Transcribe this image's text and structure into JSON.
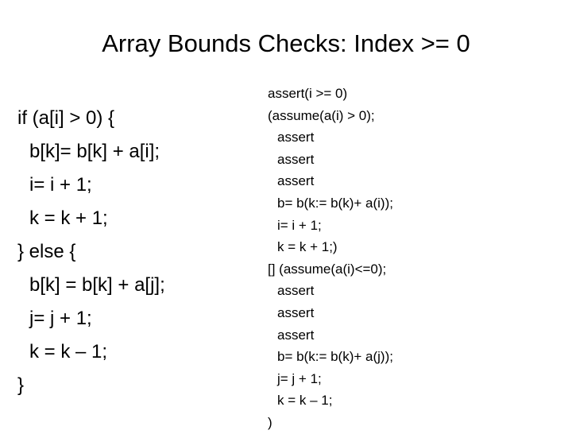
{
  "slide": {
    "title": "Array Bounds Checks: Index >= 0",
    "background_color": "#ffffff",
    "text_color": "#000000"
  },
  "left_code": {
    "name": "source-program",
    "lines": [
      {
        "text": "if (a[i] > 0) {",
        "indent": 0
      },
      {
        "text": "b[k]= b[k] + a[i];",
        "indent": 1
      },
      {
        "text": "i= i + 1;",
        "indent": 1
      },
      {
        "text": "k = k + 1;",
        "indent": 1
      },
      {
        "text": "} else {",
        "indent": 0
      },
      {
        "text": "b[k] = b[k] + a[j];",
        "indent": 1
      },
      {
        "text": "j= j + 1;",
        "indent": 1
      },
      {
        "text": "k = k – 1;",
        "indent": 1
      },
      {
        "text": "}",
        "indent": 0
      }
    ]
  },
  "right_code": {
    "name": "guarded-command-translation",
    "lines": [
      {
        "text": "assert(i >= 0)",
        "indent": 0
      },
      {
        "text": "(assume(a(i) > 0);",
        "indent": 0
      },
      {
        "text": "assert",
        "indent": 1
      },
      {
        "text": "assert",
        "indent": 1
      },
      {
        "text": "assert",
        "indent": 1
      },
      {
        "text": "b= b(k:= b(k)+ a(i));",
        "indent": 1
      },
      {
        "text": "i= i + 1;",
        "indent": 1
      },
      {
        "text": "k = k + 1;)",
        "indent": 1
      },
      {
        "text": "[] (assume(a(i)<=0);",
        "indent": 0
      },
      {
        "text": "assert",
        "indent": 1
      },
      {
        "text": "assert",
        "indent": 1
      },
      {
        "text": "assert",
        "indent": 1
      },
      {
        "text": "b= b(k:= b(k)+ a(j));",
        "indent": 1
      },
      {
        "text": "j= j + 1;",
        "indent": 1
      },
      {
        "text": "k = k – 1;",
        "indent": 1
      },
      {
        "text": ")",
        "indent": 0
      }
    ]
  }
}
